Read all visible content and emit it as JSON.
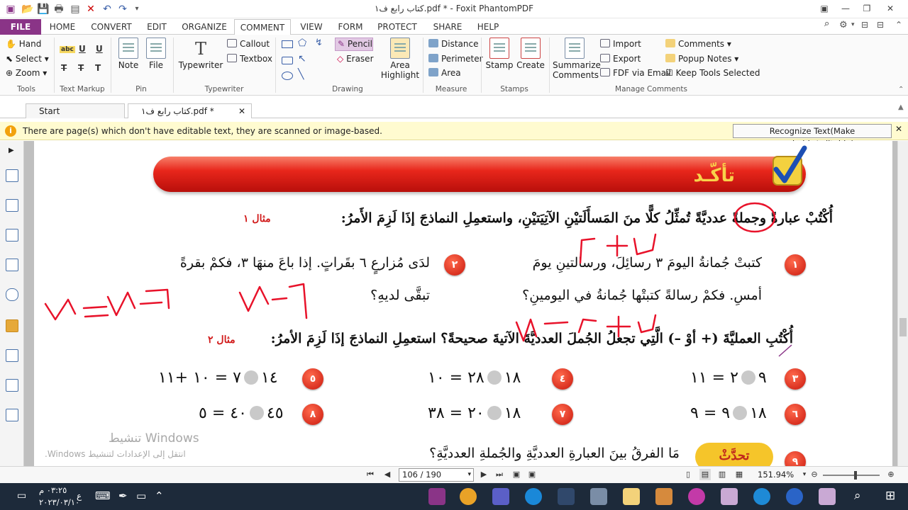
{
  "window": {
    "title": "كتاب رابع ف١.pdf * - Foxit PhantomPDF"
  },
  "menu": {
    "tabs": [
      "FILE",
      "HOME",
      "CONVERT",
      "EDIT",
      "ORGANIZE",
      "COMMENT",
      "VIEW",
      "FORM",
      "PROTECT",
      "SHARE",
      "HELP"
    ],
    "active": "COMMENT",
    "find_placeholder": "Find"
  },
  "ribbon": {
    "tools": {
      "hand": "Hand",
      "select": "Select",
      "zoom": "Zoom",
      "group": "Tools"
    },
    "text_markup": {
      "group": "Text Markup",
      "abc": "abc",
      "u1": "U",
      "u2": "U",
      "t1": "T",
      "t2": "T",
      "t3": "T"
    },
    "pin": {
      "note": "Note",
      "file": "File",
      "group": "Pin"
    },
    "typewriter": {
      "typewriter": "Typewriter",
      "callout": "Callout",
      "textbox": "Textbox",
      "group": "Typewriter"
    },
    "drawing": {
      "pencil": "Pencil",
      "eraser": "Eraser",
      "area_highlight": "Area\nHighlight",
      "group": "Drawing"
    },
    "measure": {
      "distance": "Distance",
      "perimeter": "Perimeter",
      "area": "Area",
      "group": "Measure"
    },
    "stamps": {
      "stamp": "Stamp",
      "create": "Create",
      "group": "Stamps"
    },
    "manage": {
      "summarize": "Summarize\nComments",
      "import": "Import",
      "export": "Export",
      "fdf_email": "FDF via Email",
      "comments": "Comments",
      "popup_notes": "Popup Notes",
      "keep_tools": "Keep Tools Selected",
      "group": "Manage Comments"
    }
  },
  "doc_tabs": [
    {
      "label": "Start"
    },
    {
      "label": "كتاب رابع ف١.pdf *"
    }
  ],
  "notice": {
    "text": "There are page(s) which don't have editable text, they are scanned or image-based.",
    "button": "Recognize Text(Make searchable/editable)"
  },
  "page": {
    "banner_title": "تأكّـد",
    "instruction1": "أُكْتُبْ عبارةً وجملةً عدديَّةً تُمثِّلُ كلًّا منَ المَسأَلَتيْنِ الآتِيَتيْنِ، واستعمِلِ النماذجَ إذَا لَزِمَ الأَمرُ:",
    "example1": "مثال ١",
    "q1_num": "١",
    "q1_line1": "كتبتْ جُمانةُ اليومَ ٣ رسائِلَ، ورسالتينِ يومَ",
    "q1_line2": "أمسِ. فكمْ رسالةً كتبتْها جُمانةُ في اليومينِ؟",
    "q2_num": "٢",
    "q2_line1": "لدَى مُزارعٍ ٦ بقَراتٍ. إذا باعَ منهَا ٣، فكمْ بقرةً",
    "q2_line2": "تبقَّى لديهِ؟",
    "instruction2": "أُكْتُبِ العمليَّةَ (+ أوْ –) الَّتِي تجعلُ الجُملَ العدديَّةَ الآتيةَ صحيحةً؟ استعمِلِ النماذجَ إذَا لَزِمَ الأمرُ:",
    "example2": "مثال ٢",
    "eqs": [
      {
        "num": "٣",
        "left": "٩",
        "right": "٢ = ١١"
      },
      {
        "num": "٤",
        "left": "١٨",
        "right": "٢٨ = ١٠"
      },
      {
        "num": "٥",
        "left": "١٤",
        "right": "٧ = ١٠ +١١"
      },
      {
        "num": "٦",
        "left": "١٨",
        "right": "٩ = ٩"
      },
      {
        "num": "٧",
        "left": "١٨",
        "right": "٢٠ = ٣٨"
      },
      {
        "num": "٨",
        "left": "٤٥",
        "right": "٤٠ = ٥"
      }
    ],
    "q9_num": "٩",
    "bottom_badge": "تحدَّثْ",
    "bottom_question": "مَا الفرقُ بينَ العبارةِ العدديَّةِ والجُملةِ العدديَّةِ؟",
    "watermark_title": "تنشيط Windows",
    "watermark_sub": "انتقل إلى الإعدادات لتنشيط Windows."
  },
  "navbar": {
    "page_display": "106 / 190",
    "zoom": "151.94%"
  },
  "taskbar": {
    "time": "٠٣:٢٥ م",
    "date": "٢٠٢٣/٠٣/١٠",
    "lang": "ع"
  }
}
